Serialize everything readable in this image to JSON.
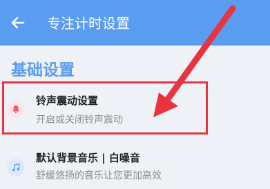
{
  "header": {
    "title": "专注计时设置",
    "back_icon": "arrow-left-icon",
    "background_color": "#5a9cf0"
  },
  "section": {
    "title": "基础设置"
  },
  "items": [
    {
      "label": "铃声震动设置",
      "subtitle": "开启或关闭铃声震动",
      "icon": "bell-icon",
      "icon_color": "#ef5a6f"
    },
    {
      "label": "默认背景音乐 | 白噪音",
      "subtitle": "舒缓悠扬的音乐让您更加高效",
      "icon": "music-note-icon",
      "icon_color": "#5a9cf0"
    }
  ],
  "annotation": {
    "color": "#e8343f"
  }
}
